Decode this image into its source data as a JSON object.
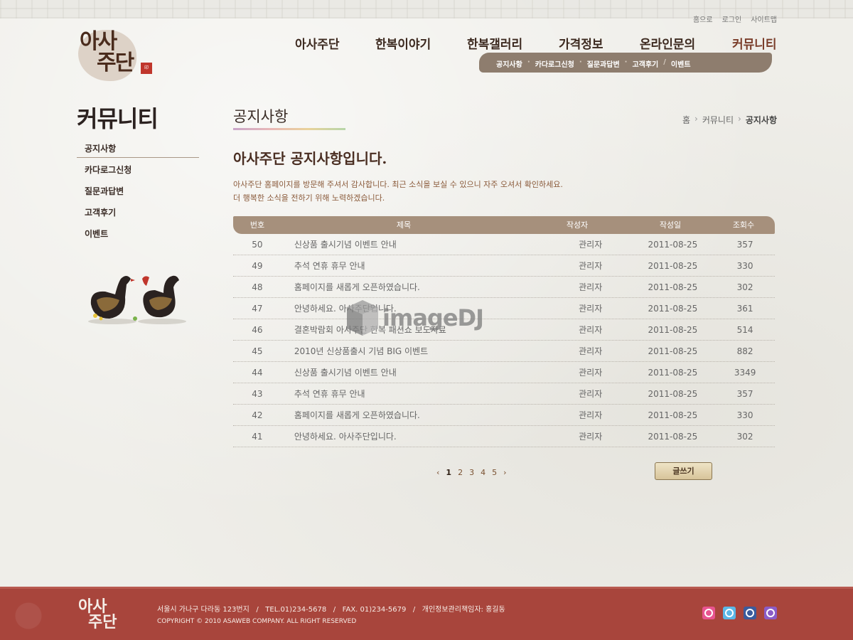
{
  "util_links": [
    "홈으로",
    "로그인",
    "사이트맵"
  ],
  "logo": {
    "line1": "아사",
    "line2": "주단"
  },
  "gnb": [
    "아사주단",
    "한복이야기",
    "한복갤러리",
    "가격정보",
    "온라인문의",
    "커뮤니티"
  ],
  "subnav": [
    "공지사항",
    "카다로그신청",
    "질문과답변",
    "고객후기",
    "이벤트"
  ],
  "sidebar": {
    "title": "커뮤니티",
    "items": [
      "공지사항",
      "카다로그신청",
      "질문과답변",
      "고객후기",
      "이벤트"
    ]
  },
  "content": {
    "page_title": "공지사항",
    "breadcrumb": [
      "홈",
      "커뮤니티",
      "공지사항"
    ],
    "headline": "아사주단 공지사항입니다.",
    "intro_line1": "아사주단 홈페이지를 방문해 주셔서 감사합니다. 최근 소식을 보실 수 있으니 자주 오셔서 확인하세요.",
    "intro_line2": "더 행복한 소식을 전하기 위해 노력하겠습니다."
  },
  "table": {
    "headers": [
      "번호",
      "제목",
      "작성자",
      "작성일",
      "조회수"
    ],
    "rows": [
      [
        "50",
        "신상품 출시기념 이벤트 안내",
        "관리자",
        "2011-08-25",
        "357"
      ],
      [
        "49",
        "추석 연휴 휴무 안내",
        "관리자",
        "2011-08-25",
        "330"
      ],
      [
        "48",
        "홈페이지를 새롭게 오픈하였습니다.",
        "관리자",
        "2011-08-25",
        "302"
      ],
      [
        "47",
        "안녕하세요. 아사주단입니다.",
        "관리자",
        "2011-08-25",
        "361"
      ],
      [
        "46",
        "결혼박람회 아사주단 한복 패션쇼 보도자료",
        "관리자",
        "2011-08-25",
        "514"
      ],
      [
        "45",
        "2010년 신상품출시 기념 BIG 이벤트",
        "관리자",
        "2011-08-25",
        "882"
      ],
      [
        "44",
        "신상품 출시기념 이벤트 안내",
        "관리자",
        "2011-08-25",
        "3349"
      ],
      [
        "43",
        "추석 연휴 휴무 안내",
        "관리자",
        "2011-08-25",
        "357"
      ],
      [
        "42",
        "홈페이지를 새롭게 오픈하였습니다.",
        "관리자",
        "2011-08-25",
        "330"
      ],
      [
        "41",
        "안녕하세요. 아사주단입니다.",
        "관리자",
        "2011-08-25",
        "302"
      ]
    ]
  },
  "pager": {
    "prev": "‹",
    "pages": [
      "1",
      "2",
      "3",
      "4",
      "5"
    ],
    "current": "1",
    "next": "›"
  },
  "write_button": "글쓰기",
  "watermark": "imageDJ",
  "footer": {
    "logo_line1": "아사",
    "logo_line2": "주단",
    "address_line": "서울시 가나구 다라동 123번지   /   TEL.01)234-5678   /   FAX. 01)234-5679   /   개인정보관리책임자: 홍길동",
    "copyright": "COPYRIGHT © 2010 ASAWEB COMPANY. ALL RIGHT RESERVED",
    "sns_icons": [
      "me2day-icon",
      "twitter-icon",
      "facebook-icon",
      "yozm-icon"
    ],
    "sns_colors": [
      "#e8548f",
      "#5bb7e6",
      "#3b5b9c",
      "#8b5cc7"
    ]
  }
}
